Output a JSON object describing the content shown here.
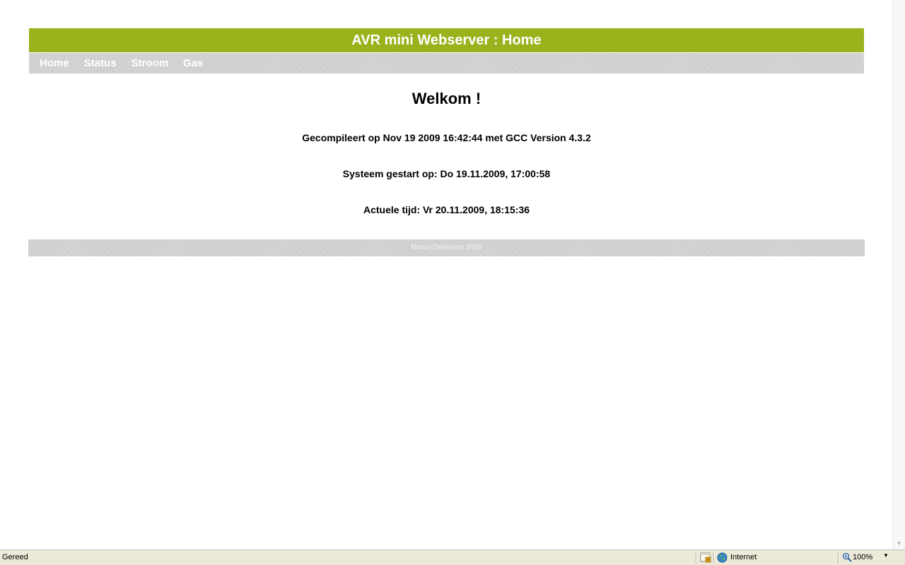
{
  "header": {
    "title": "AVR mini Webserver : Home",
    "color": "#99b31c"
  },
  "nav": {
    "items": [
      {
        "label": "Home"
      },
      {
        "label": "Status"
      },
      {
        "label": "Stroom"
      },
      {
        "label": "Gas"
      }
    ]
  },
  "main": {
    "heading": "Welkom !",
    "compiled": "Gecompileert op Nov 19 2009 16:42:44 met GCC Version 4.3.2",
    "started": "Systeem gestart op: Do 19.11.2009, 17:00:58",
    "current_time": "Actuele tijd: Vr 20.11.2009, 18:15:36"
  },
  "footer": {
    "text": "Marco Driessens 2009"
  },
  "statusbar": {
    "status": "Gereed",
    "zone": "Internet",
    "zoom": "100%",
    "icons": [
      "protected-mode-icon",
      "globe-icon",
      "zoom-icon"
    ]
  }
}
